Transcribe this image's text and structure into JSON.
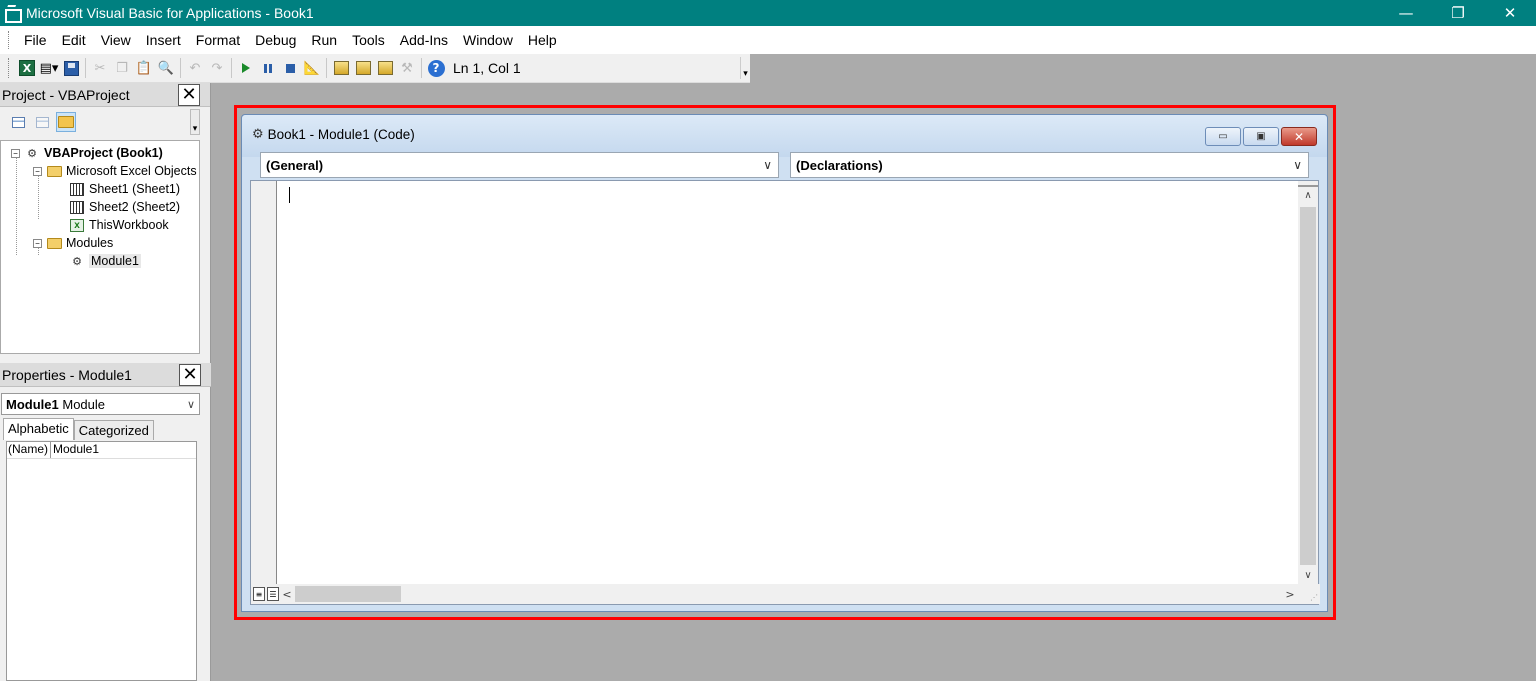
{
  "window": {
    "title": "Microsoft Visual Basic for Applications - Book1",
    "controls": {
      "minimize": "—",
      "restore": "❐",
      "close": "✕"
    }
  },
  "menu": [
    "File",
    "Edit",
    "View",
    "Insert",
    "Format",
    "Debug",
    "Run",
    "Tools",
    "Add-Ins",
    "Window",
    "Help"
  ],
  "toolbar": {
    "position_text": "Ln 1, Col 1",
    "buttons": [
      "excel-icon",
      "insert-module-icon",
      "save-icon",
      "cut-icon",
      "copy-icon",
      "paste-icon",
      "find-icon",
      "undo-icon",
      "redo-icon",
      "run-icon",
      "break-icon",
      "reset-icon",
      "design-mode-icon",
      "project-explorer-icon",
      "properties-icon",
      "object-browser-icon",
      "toolbox-icon",
      "help-icon"
    ]
  },
  "project_pane": {
    "title": "Project - VBAProject",
    "close": "✕",
    "tree": {
      "root": "VBAProject (Book1)",
      "excel_objects": "Microsoft Excel Objects",
      "sheet1": "Sheet1 (Sheet1)",
      "sheet2": "Sheet2 (Sheet2)",
      "workbook": "ThisWorkbook",
      "modules": "Modules",
      "module1": "Module1"
    }
  },
  "properties_pane": {
    "title": "Properties - Module1",
    "close": "✕",
    "object_name": "Module1",
    "object_type": "Module",
    "tabs": [
      "Alphabetic",
      "Categorized"
    ],
    "rows": [
      {
        "key": "(Name)",
        "value": "Module1"
      }
    ]
  },
  "code_window": {
    "title": "Book1 - Module1 (Code)",
    "object_combo": "(General)",
    "procedure_combo": "(Declarations)",
    "code": "",
    "highlight_color": "#ff0000"
  }
}
